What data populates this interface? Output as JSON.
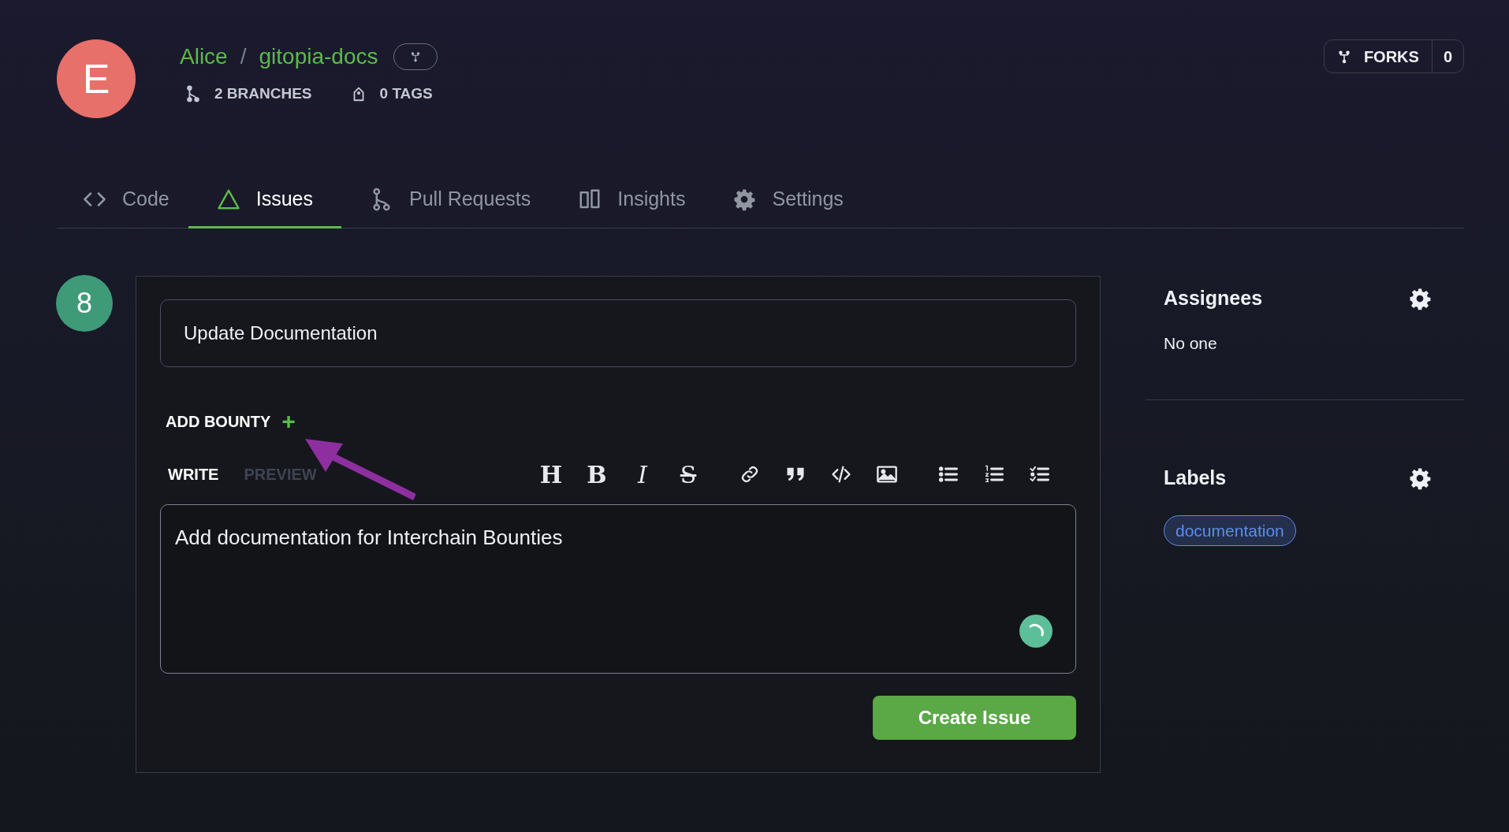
{
  "repo": {
    "avatar_letter": "E",
    "owner": "Alice",
    "separator": "/",
    "name": "gitopia-docs",
    "branches": "2 BRANCHES",
    "tags": "0 TAGS"
  },
  "forks": {
    "label": "FORKS",
    "count": "0"
  },
  "tabs": [
    {
      "kind": "code",
      "label": "Code",
      "selected": false
    },
    {
      "kind": "issues",
      "label": "Issues",
      "selected": true
    },
    {
      "kind": "pulls",
      "label": "Pull Requests",
      "selected": false
    },
    {
      "kind": "insights",
      "label": "Insights",
      "selected": false
    },
    {
      "kind": "settings",
      "label": "Settings",
      "selected": false
    }
  ],
  "issue": {
    "number": "8",
    "title": "Update Documentation",
    "add_bounty": "ADD BOUNTY",
    "add_bounty_plus": "+",
    "editor_tabs": [
      {
        "label": "WRITE",
        "selected": true
      },
      {
        "label": "PREVIEW",
        "selected": false
      }
    ],
    "toolbar": [
      {
        "kind": "heading",
        "label": "H"
      },
      {
        "kind": "bold",
        "label": "B"
      },
      {
        "kind": "italic",
        "label": "I"
      },
      {
        "kind": "strike",
        "label": "S"
      },
      {
        "kind": "link"
      },
      {
        "kind": "quote"
      },
      {
        "kind": "code"
      },
      {
        "kind": "image"
      },
      {
        "kind": "bullets"
      },
      {
        "kind": "numbers"
      },
      {
        "kind": "tasks"
      }
    ],
    "body": "Add documentation for Interchain Bounties",
    "submit": "Create Issue"
  },
  "sidebar": [
    {
      "heading": "Assignees",
      "value": "No one"
    },
    {
      "heading": "Labels",
      "labels": [
        {
          "name": "documentation",
          "color": "#5b8def"
        }
      ]
    }
  ]
}
